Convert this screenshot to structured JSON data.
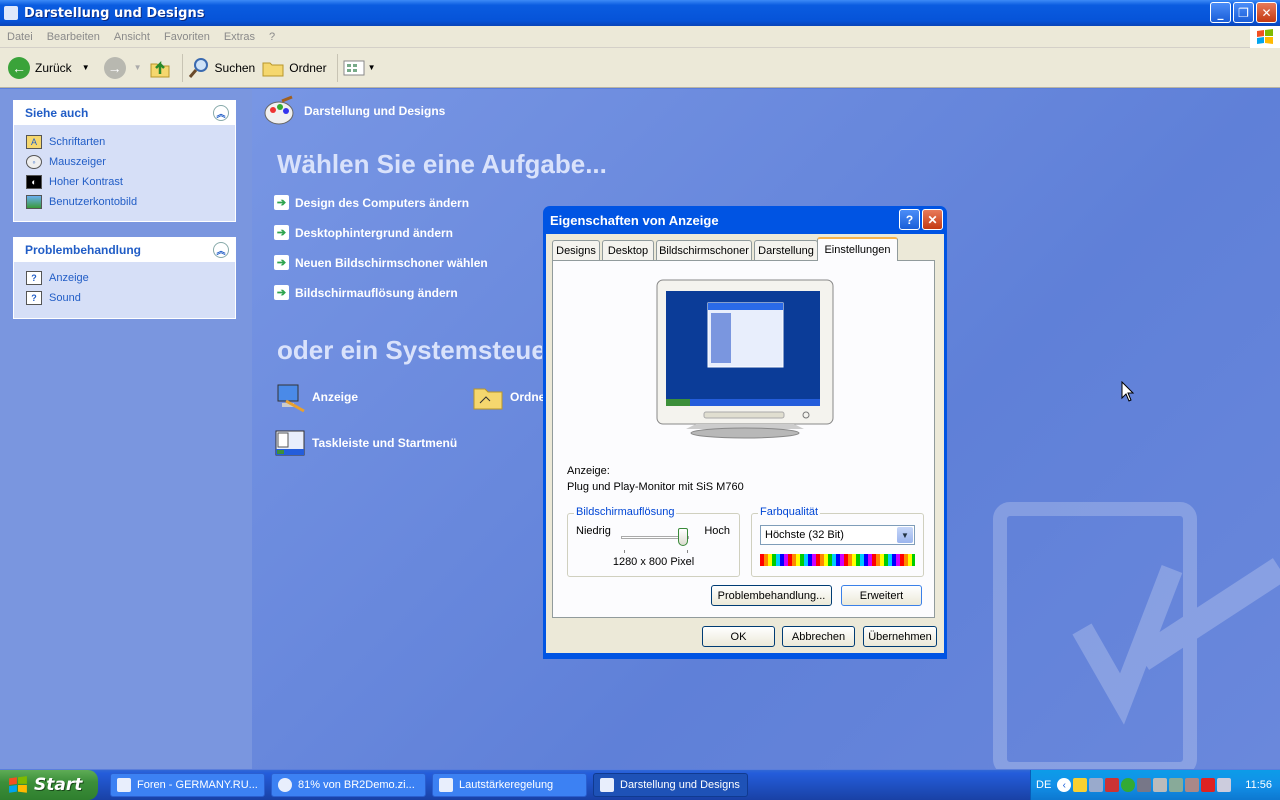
{
  "window": {
    "title": "Darstellung und Designs",
    "buttons": {
      "minimize": "_",
      "maximize": "❐",
      "close": "✕"
    }
  },
  "menu": [
    "Datei",
    "Bearbeiten",
    "Ansicht",
    "Favoriten",
    "Extras",
    "?"
  ],
  "toolbar": {
    "back": "Zurück",
    "search": "Suchen",
    "folders": "Ordner"
  },
  "sidebar": {
    "see_also": {
      "title": "Siehe auch",
      "items": [
        "Schriftarten",
        "Mauszeiger",
        "Hoher Kontrast",
        "Benutzerkontobild"
      ]
    },
    "troubleshoot": {
      "title": "Problembehandlung",
      "items": [
        "Anzeige",
        "Sound"
      ]
    }
  },
  "main": {
    "category": "Darstellung und Designs",
    "task_title": "Wählen Sie eine Aufgabe...",
    "tasks": [
      "Design des Computers ändern",
      "Desktophintergrund ändern",
      "Neuen Bildschirmschoner wählen",
      "Bildschirmauflösung ändern"
    ],
    "or_title": "oder ein Systemsteuerungssymbol",
    "icons": [
      "Anzeige",
      "Ordneroptionen",
      "Taskleiste und Startmenü"
    ]
  },
  "dialog": {
    "title": "Eigenschaften von Anzeige",
    "help": "?",
    "close": "✕",
    "tabs": [
      "Designs",
      "Desktop",
      "Bildschirmschoner",
      "Darstellung",
      "Einstellungen"
    ],
    "active_tab": "Einstellungen",
    "display_label": "Anzeige:",
    "display_value": "Plug und Play-Monitor mit SiS M760",
    "resolution": {
      "group": "Bildschirmauflösung",
      "low": "Niedrig",
      "high": "Hoch",
      "value": "1280 x 800 Pixel",
      "slider_fraction": 1.0
    },
    "color": {
      "group": "Farbqualität",
      "selected": "Höchste (32 Bit)"
    },
    "buttons": {
      "troubleshoot": "Problembehandlung...",
      "advanced": "Erweitert",
      "ok": "OK",
      "cancel": "Abbrechen",
      "apply": "Übernehmen"
    }
  },
  "taskbar": {
    "start": "Start",
    "tasks": [
      "Foren - GERMANY.RU...",
      "81% von BR2Demo.zi...",
      "Lautstärkeregelung",
      "Darstellung und Designs"
    ],
    "language": "DE",
    "clock": "11:56"
  },
  "colors": {
    "xp_blue": "#0054e3",
    "main_bg": "#6a88dc",
    "sidebar_bg": "#7a96df",
    "link_blue": "#215dc6"
  }
}
